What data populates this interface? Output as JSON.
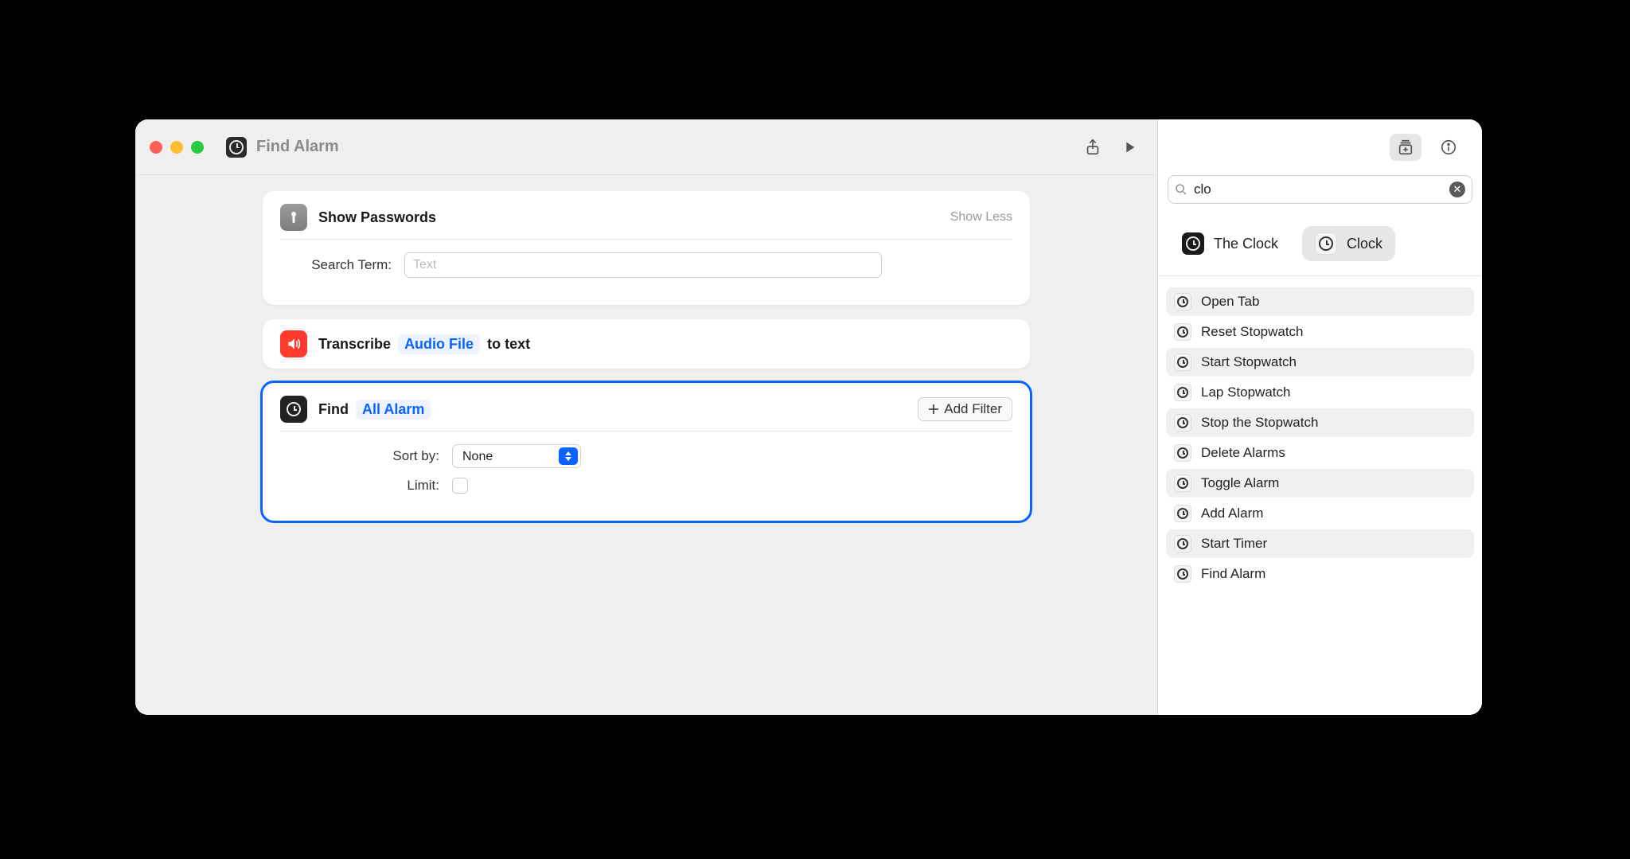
{
  "window": {
    "title": "Find Alarm"
  },
  "actions": {
    "passwords": {
      "title": "Show Passwords",
      "show_less": "Show Less",
      "search_term_label": "Search Term:",
      "search_placeholder": "Text"
    },
    "transcribe": {
      "prefix": "Transcribe",
      "token": "Audio File",
      "suffix": "to text"
    },
    "find_alarm": {
      "prefix": "Find",
      "token": "All Alarm",
      "add_filter": "Add Filter",
      "sort_by_label": "Sort by:",
      "sort_by_value": "None",
      "limit_label": "Limit:"
    }
  },
  "sidebar": {
    "search_value": "clo",
    "apps": [
      {
        "name": "The Clock",
        "selected": false,
        "icon": "dark"
      },
      {
        "name": "Clock",
        "selected": true,
        "icon": "white"
      }
    ],
    "action_list": [
      "Open Tab",
      "Reset Stopwatch",
      "Start Stopwatch",
      "Lap Stopwatch",
      "Stop the Stopwatch",
      "Delete Alarms",
      "Toggle Alarm",
      "Add Alarm",
      "Start Timer",
      "Find Alarm"
    ]
  }
}
